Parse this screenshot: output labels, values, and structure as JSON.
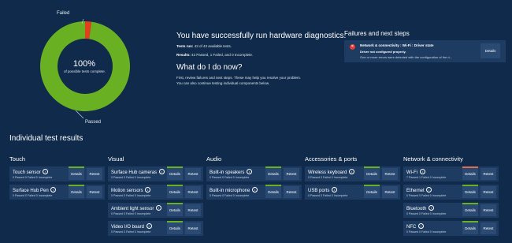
{
  "summary": {
    "percent": "100%",
    "percent_sub": "of possible tests complete.",
    "failed_label": "Failed",
    "passed_label": "Passed",
    "chart_colors": {
      "passed": "#6ab023",
      "failed": "#e2401b"
    }
  },
  "chart_data": {
    "type": "pie",
    "categories": [
      "Passed",
      "Failed"
    ],
    "values": [
      42,
      1
    ]
  },
  "result": {
    "heading": "You have successfully run hardware diagnostics.",
    "tests_run_label": "Tests run:",
    "tests_run_value": "43 of 43 available tests.",
    "results_label": "Results:",
    "results_value": "42 Passed, 1 Failed, and 0 Incomplete.",
    "next_heading": "What do I do now?",
    "next_line1": "First, review failures and next steps.  These may help you resolve your problem.",
    "next_line2": "You can also continue testing individual components below."
  },
  "failures": {
    "heading": "Failures and next steps",
    "title": "Network & connectivity : Wi-Fi : Driver state",
    "subtitle": "Driver not configured properly.",
    "detail": "One or more errors were detected with the configuration of the d...",
    "button": "Details"
  },
  "individual_heading": "Individual test results",
  "columns": [
    {
      "title": "Touch",
      "items": [
        {
          "name": "Touch sensor",
          "status": "0 Passed  0 Failed  0 Incomplete",
          "details": "Details",
          "retest": "Retest"
        },
        {
          "name": "Surface Hub Pen",
          "status": "0 Passed  0 Failed  0 Incomplete",
          "details": "Details",
          "retest": "Retest"
        }
      ]
    },
    {
      "title": "Visual",
      "items": [
        {
          "name": "Surface Hub cameras",
          "status": "0 Passed  0 Failed  0 Incomplete",
          "details": "Details",
          "retest": "Retest"
        },
        {
          "name": "Motion sensors",
          "status": "0 Passed  0 Failed  0 Incomplete",
          "details": "Details",
          "retest": "Retest"
        },
        {
          "name": "Ambient light sensor",
          "status": "0 Passed  0 Failed  0 Incomplete",
          "details": "Details",
          "retest": "Retest"
        },
        {
          "name": "Video I/O board",
          "status": "0 Passed  0 Failed  0 Incomplete",
          "details": "Details",
          "retest": "Retest"
        }
      ]
    },
    {
      "title": "Audio",
      "items": [
        {
          "name": "Built-in speakers",
          "status": "0 Passed  0 Failed  0 Incomplete",
          "details": "Details",
          "retest": "Retest"
        },
        {
          "name": "Built-in microphone",
          "status": "0 Passed  0 Failed  0 Incomplete",
          "details": "Details",
          "retest": "Retest"
        }
      ]
    },
    {
      "title": "Accessories & ports",
      "items": [
        {
          "name": "Wireless keyboard",
          "status": "0 Passed  0 Failed  0 Incomplete",
          "details": "Details",
          "retest": "Retest"
        },
        {
          "name": "USB ports",
          "status": "0 Passed  0 Failed  0 Incomplete",
          "details": "Details",
          "retest": "Retest"
        }
      ]
    },
    {
      "title": "Network & connectivity",
      "items": [
        {
          "name": "Wi-Fi",
          "status": "7 Passed  1 Failed  0 Incomplete",
          "details": "Details",
          "retest": "Retest",
          "failed": true
        },
        {
          "name": "Ethernet",
          "status": "0 Passed  0 Failed  0 Incomplete",
          "details": "Details",
          "retest": "Retest"
        },
        {
          "name": "Bluetooth",
          "status": "0 Passed  0 Failed  0 Incomplete",
          "details": "Details",
          "retest": "Retest"
        },
        {
          "name": "NFC",
          "status": "0 Passed  0 Failed  0 Incomplete",
          "details": "Details",
          "retest": "Retest"
        }
      ]
    }
  ]
}
